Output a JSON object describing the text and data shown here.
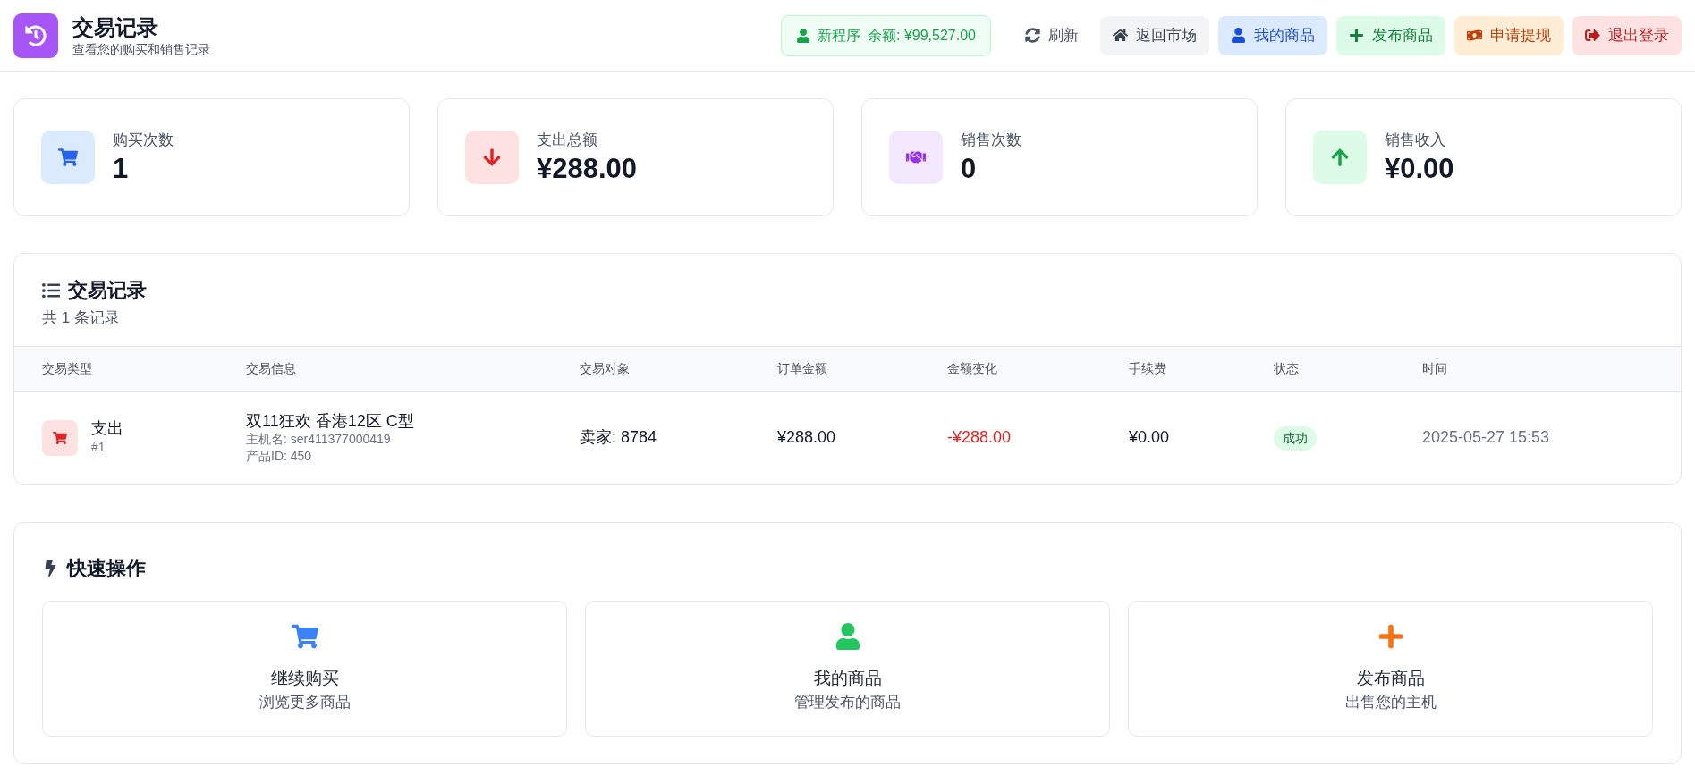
{
  "header": {
    "title": "交易记录",
    "subtitle": "查看您的购买和销售记录",
    "user": {
      "name": "新程序",
      "balance": "余额: ¥99,527.00"
    },
    "actions": [
      {
        "kind": "refresh",
        "label": "刷新"
      },
      {
        "kind": "home",
        "label": "返回市场"
      },
      {
        "kind": "user",
        "label": "我的商品"
      },
      {
        "kind": "plus",
        "label": "发布商品"
      },
      {
        "kind": "money",
        "label": "申请提现"
      },
      {
        "kind": "logout",
        "label": "退出登录"
      }
    ]
  },
  "stats": [
    {
      "kind": "cart",
      "label": "购买次数",
      "value": "1"
    },
    {
      "kind": "down",
      "label": "支出总额",
      "value": "¥288.00"
    },
    {
      "kind": "handshake",
      "label": "销售次数",
      "value": "0"
    },
    {
      "kind": "up",
      "label": "销售收入",
      "value": "¥0.00"
    }
  ],
  "records": {
    "title": "交易记录",
    "count": "共 1 条记录",
    "columns": [
      "交易类型",
      "交易信息",
      "交易对象",
      "订单金额",
      "金额变化",
      "手续费",
      "状态",
      "时间"
    ],
    "rows": [
      {
        "kind": "expense",
        "type": "支出",
        "index": "#1",
        "product": "双11狂欢 香港12区 C型",
        "host": "主机名: ser411377000419",
        "product_id": "产品ID: 450",
        "counterparty": "卖家: 8784",
        "amount": "¥288.00",
        "change": "-¥288.00",
        "fee": "¥0.00",
        "status": "成功",
        "time": "2025-05-27 15:53"
      }
    ]
  },
  "quick_actions": {
    "title": "快速操作",
    "items": [
      {
        "kind": "cart",
        "title": "继续购买",
        "subtitle": "浏览更多商品"
      },
      {
        "kind": "user",
        "title": "我的商品",
        "subtitle": "管理发布的商品"
      },
      {
        "kind": "plus",
        "title": "发布商品",
        "subtitle": "出售您的主机"
      }
    ]
  }
}
